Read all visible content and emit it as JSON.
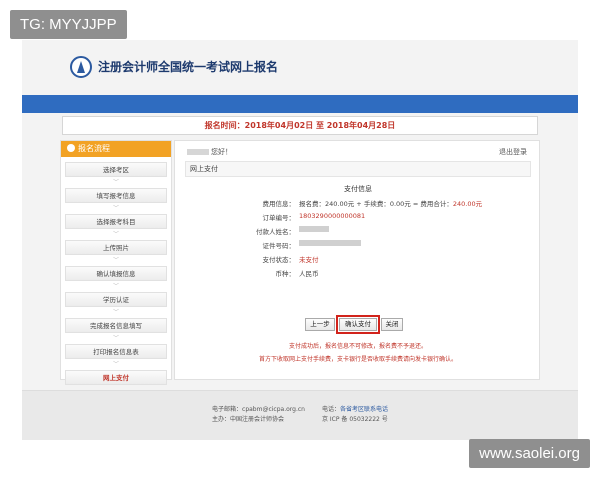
{
  "watermarks": {
    "top_left": "TG: MYYJJPP",
    "bottom_right": "www.saolei.org"
  },
  "header": {
    "title": "注册会计师全国统一考试网上报名"
  },
  "date_banner": "报名时间：2018年04月02日 至 2018年04月28日",
  "sidebar": {
    "header": "报名流程",
    "items": [
      {
        "label": "选择考区"
      },
      {
        "label": "填写报考信息"
      },
      {
        "label": "选择报考科目"
      },
      {
        "label": "上传照片"
      },
      {
        "label": "确认填报信息"
      },
      {
        "label": "学历认证"
      },
      {
        "label": "完成报名信息填写"
      },
      {
        "label": "打印报名信息表"
      },
      {
        "label": "网上支付"
      }
    ],
    "active_index": 8
  },
  "main": {
    "greeting": "您好！",
    "logout": "退出登录",
    "section_title": "网上支付",
    "payment_title": "支付信息",
    "fields": [
      {
        "label": "费用信息：",
        "value": "报名费：240.00元 + 手续费：0.00元 = 费用合计：240.00元",
        "highlight": false
      },
      {
        "label": "订单编号：",
        "value": "1803290000000081",
        "highlight": true
      },
      {
        "label": "付款人姓名：",
        "value": "",
        "blurred": true
      },
      {
        "label": "证件号码：",
        "value": "",
        "blurred": true
      },
      {
        "label": "支付状态：",
        "value": "未支付",
        "highlight": true
      },
      {
        "label": "币种：",
        "value": "人民币",
        "highlight": false
      }
    ],
    "buttons": {
      "prev": "上一步",
      "confirm": "确认支付",
      "close": "关闭"
    },
    "notes": [
      "支付成功后，报名信息不可修改，报名费不予退还。",
      "首方下收取网上支付手续费，支卡银行是否收取手续费请向发卡银行确认。"
    ]
  },
  "footer": {
    "email_label": "电子邮箱：",
    "email_value": "cpabm@cicpa.org.cn",
    "sponsor_label": "主办：",
    "sponsor_value": "中国注册会计师协会",
    "phone_label": "电话：",
    "phone_value": "各省考区联系电话",
    "icp_label": "京 ICP 备",
    "icp_value": "05032222 号"
  }
}
